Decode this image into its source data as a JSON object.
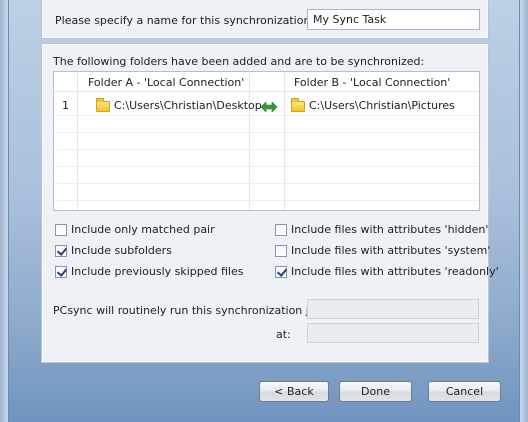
{
  "job_name": {
    "label": "Please specify a name for this synchronization job:",
    "value": "My Sync Task"
  },
  "folders": {
    "intro": "The following folders have been added and are to be synchronized:",
    "header_a": "Folder A - 'Local Connection'",
    "header_b": "Folder B - 'Local Connection'",
    "rows": [
      {
        "index": "1",
        "folder_a": "C:\\Users\\Christian\\Desktop",
        "folder_b": "C:\\Users\\Christian\\Pictures"
      }
    ]
  },
  "options": {
    "matched_pair": {
      "label": "Include only matched pair",
      "checked": false
    },
    "subfolders": {
      "label": "Include subfolders",
      "checked": true
    },
    "skipped_files": {
      "label": "Include previously skipped files",
      "checked": true
    },
    "attr_hidden": {
      "label": "Include files with attributes 'hidden'",
      "checked": false
    },
    "attr_system": {
      "label": "Include files with attributes 'system'",
      "checked": false
    },
    "attr_readonly": {
      "label": "Include files with attributes 'readonly'",
      "checked": true
    }
  },
  "schedule": {
    "run_label": "PCsync will routinely run this synchronization job:",
    "at_label": "at:",
    "run_value": "",
    "at_value": ""
  },
  "buttons": {
    "back": "< Back",
    "done": "Done",
    "cancel": "Cancel"
  },
  "colors": {
    "sync_arrows": "#2f9e3a",
    "folder": "#f3c432"
  }
}
